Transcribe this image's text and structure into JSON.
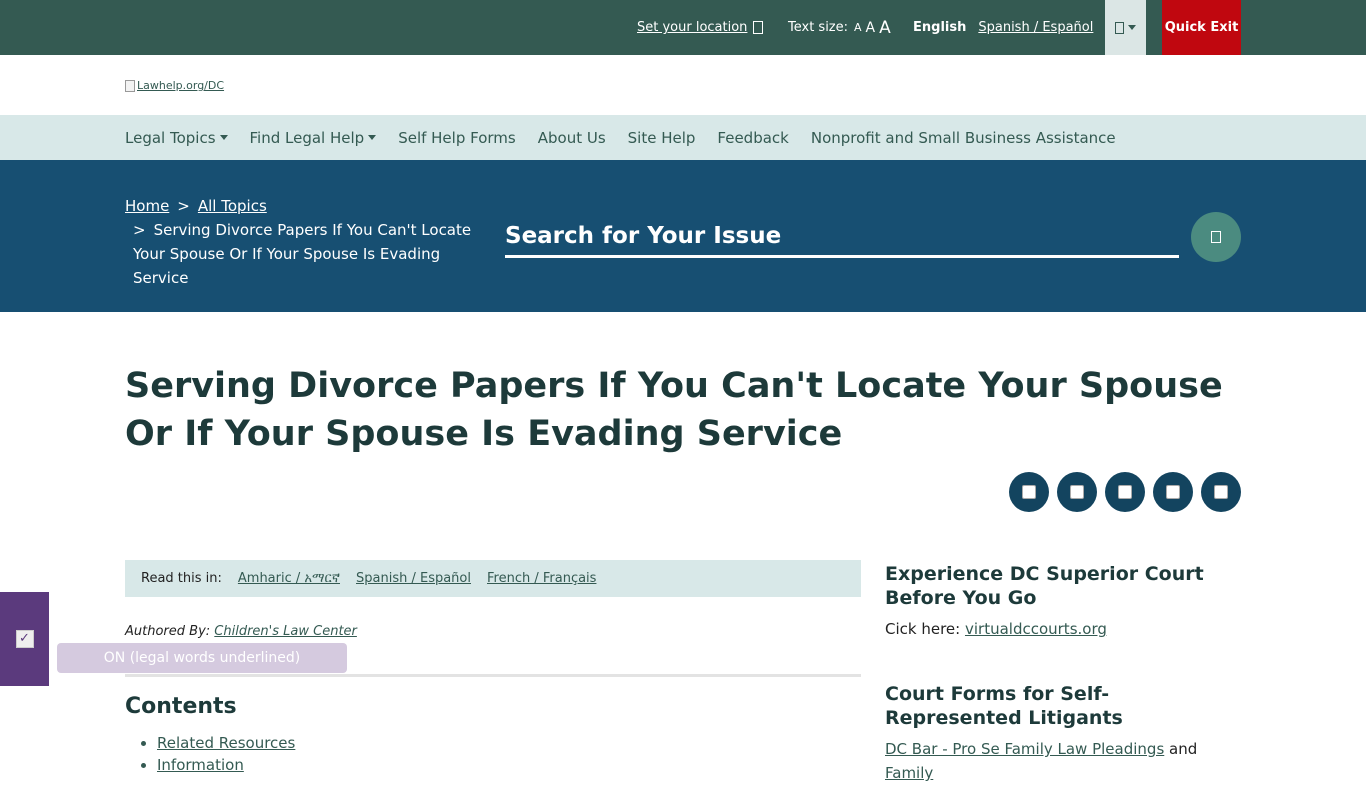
{
  "topbar": {
    "location": "Set your location",
    "text_size_label": "Text size:",
    "text_size_options": [
      "A",
      "A",
      "A"
    ],
    "lang_current": "English",
    "lang_alt": "Spanish / Español",
    "quick_exit": "Quick Exit"
  },
  "logo": {
    "alt": "Lawhelp.org/DC"
  },
  "nav": {
    "items": [
      "Legal Topics",
      "Find Legal Help",
      "Self Help Forms",
      "About Us",
      "Site Help",
      "Feedback",
      "Nonprofit and Small Business Assistance"
    ]
  },
  "breadcrumb": {
    "home": "Home",
    "sep": ">",
    "all_topics": "All Topics",
    "current": "Serving Divorce Papers If You Can't Locate Your Spouse Or If Your Spouse Is Evading Service"
  },
  "search": {
    "placeholder": "Search for Your Issue"
  },
  "page": {
    "title": "Serving Divorce Papers If You Can't Locate Your Spouse Or If Your Spouse Is Evading Service"
  },
  "readin": {
    "label": "Read this in:",
    "languages": [
      "Amharic / አማርኛ",
      "Spanish / Español",
      "French / Français"
    ]
  },
  "author": {
    "label": "Authored By:",
    "name": "Children's Law Center"
  },
  "contents": {
    "heading": "Contents",
    "items": [
      "Related Resources",
      "Information"
    ]
  },
  "sidebar": {
    "block1": {
      "heading": "Experience DC Superior Court Before You Go",
      "text": "Cick here:",
      "link": "virtualdccourts.org"
    },
    "block2": {
      "heading": "Court Forms for Self-Represented Litigants",
      "link1": "DC Bar - Pro Se Family Law Pleadings",
      "and": "and",
      "link2": "Family"
    }
  },
  "glossary": {
    "tooltip": "ON (legal words underlined)",
    "check": "✓"
  },
  "colors": {
    "topbar": "#345a52",
    "nav_bg": "#d8e8e8",
    "hero": "#174f72",
    "quick_exit": "#c0070f",
    "glossary": "#5b3a7d"
  }
}
